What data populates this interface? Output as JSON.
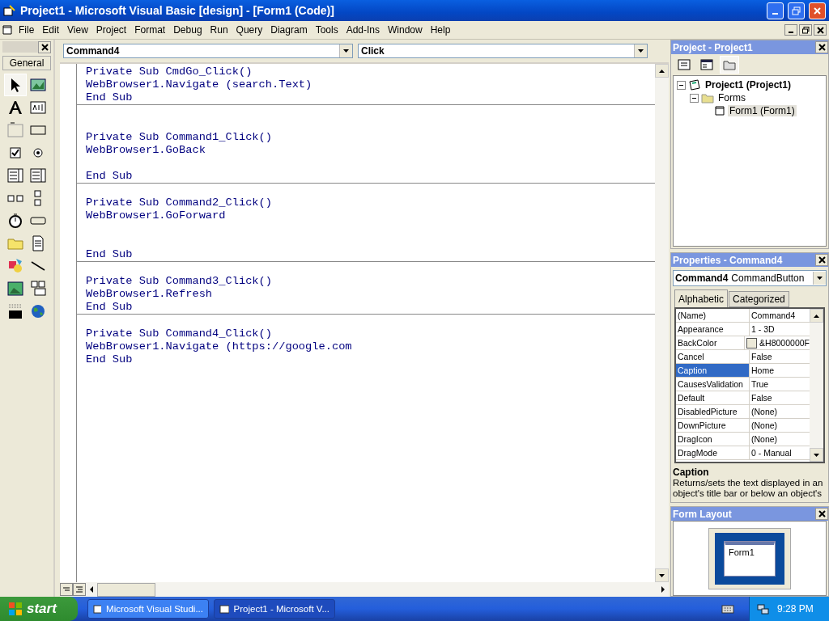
{
  "window": {
    "title": "Project1 - Microsoft Visual Basic [design] - [Form1 (Code)]"
  },
  "menu": [
    "File",
    "Edit",
    "View",
    "Project",
    "Format",
    "Debug",
    "Run",
    "Query",
    "Diagram",
    "Tools",
    "Add-Ins",
    "Window",
    "Help"
  ],
  "toolbox": {
    "tab": "General"
  },
  "code_window": {
    "object_combo": "Command4",
    "procedure_combo": "Click",
    "procedures": [
      {
        "lines": [
          {
            "kind": "code",
            "text": "Private Sub CmdGo_Click()"
          },
          {
            "kind": "code",
            "text": "WebBrowser1.Navigate (search.Text)"
          },
          {
            "kind": "code",
            "text": "End Sub"
          }
        ]
      },
      {
        "lines": [
          {
            "kind": "blank"
          },
          {
            "kind": "blank"
          },
          {
            "kind": "code",
            "text": "Private Sub Command1_Click()"
          },
          {
            "kind": "code",
            "text": "WebBrowser1.GoBack"
          },
          {
            "kind": "blank"
          },
          {
            "kind": "code",
            "text": "End Sub"
          }
        ]
      },
      {
        "lines": [
          {
            "kind": "blank"
          },
          {
            "kind": "code",
            "text": "Private Sub Command2_Click()"
          },
          {
            "kind": "code",
            "text": "WebBrowser1.GoForward"
          },
          {
            "kind": "blank"
          },
          {
            "kind": "blank"
          },
          {
            "kind": "code",
            "text": "End Sub"
          }
        ]
      },
      {
        "lines": [
          {
            "kind": "blank"
          },
          {
            "kind": "code",
            "text": "Private Sub Command3_Click()"
          },
          {
            "kind": "code",
            "text": "WebBrowser1.Refresh"
          },
          {
            "kind": "code",
            "text": "End Sub"
          }
        ]
      },
      {
        "lines": [
          {
            "kind": "blank"
          },
          {
            "kind": "code",
            "text": "Private Sub Command4_Click()"
          },
          {
            "kind": "code",
            "text": "WebBrowser1.Navigate (https://google.com"
          },
          {
            "kind": "code",
            "text": "End Sub"
          }
        ]
      }
    ]
  },
  "project_panel": {
    "title": "Project - Project1",
    "tree": [
      {
        "label": "Project1 (Project1)",
        "expanded": true,
        "selected": false,
        "children": [
          {
            "label": "Forms",
            "expanded": true,
            "selected": false,
            "children": [
              {
                "label": "Form1 (Form1)",
                "selected": true
              }
            ]
          }
        ]
      }
    ]
  },
  "properties_panel": {
    "title": "Properties - Command4",
    "object_name": "Command4",
    "object_type": "CommandButton",
    "tabs": [
      {
        "label": "Alphabetic",
        "selected": true
      },
      {
        "label": "Categorized",
        "selected": false
      }
    ],
    "rows": [
      {
        "name": "(Name)",
        "value": "Command4",
        "selected": false
      },
      {
        "name": "Appearance",
        "value": "1 - 3D",
        "selected": false
      },
      {
        "name": "BackColor",
        "value": "&H8000000F",
        "selected": false,
        "color": "#ece9d8"
      },
      {
        "name": "Cancel",
        "value": "False",
        "selected": false
      },
      {
        "name": "Caption",
        "value": "Home",
        "selected": true
      },
      {
        "name": "CausesValidation",
        "value": "True",
        "selected": false
      },
      {
        "name": "Default",
        "value": "False",
        "selected": false
      },
      {
        "name": "DisabledPicture",
        "value": "(None)",
        "selected": false
      },
      {
        "name": "DownPicture",
        "value": "(None)",
        "selected": false
      },
      {
        "name": "DragIcon",
        "value": "(None)",
        "selected": false
      },
      {
        "name": "DragMode",
        "value": "0 - Manual",
        "selected": false
      }
    ],
    "description_title": "Caption",
    "description": "Returns/sets the text displayed in an object's title bar or below an object's"
  },
  "form_layout": {
    "title": "Form Layout",
    "form_label": "Form1"
  },
  "taskbar": {
    "start": "start",
    "tasks": [
      {
        "label": "Microsoft Visual Studi...",
        "selected": false
      },
      {
        "label": "Project1 - Microsoft V...",
        "selected": true
      }
    ],
    "clock": "9:28 PM"
  }
}
